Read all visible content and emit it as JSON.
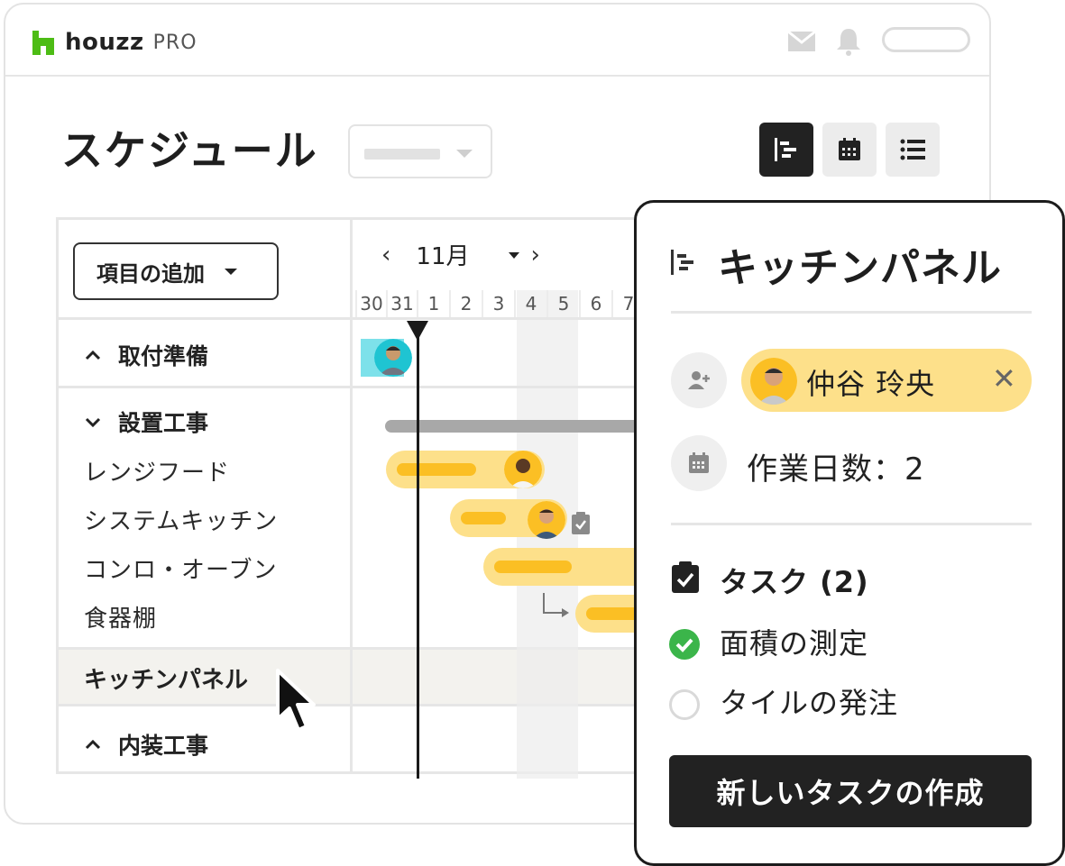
{
  "app": {
    "brand": "houzz",
    "brand_suffix": "PRO",
    "brand_color": "#4dbc15"
  },
  "header": {
    "icons": [
      "mail-icon",
      "bell-icon"
    ]
  },
  "page": {
    "title": "スケジュール"
  },
  "view_toggle": {
    "active": "gantt",
    "options": [
      "gantt",
      "calendar",
      "list"
    ]
  },
  "schedule": {
    "add_button_label": "項目の追加",
    "month_label": "11月",
    "days": [
      "30",
      "31",
      "1",
      "2",
      "3",
      "4",
      "5",
      "6",
      "7"
    ],
    "groups": [
      {
        "label": "取付準備",
        "expanded": false
      },
      {
        "label": "設置工事",
        "expanded": true,
        "items": [
          "レンジフード",
          "システムキッチン",
          "コンロ・オーブン",
          "食器棚"
        ]
      },
      {
        "label": "キッチンパネル",
        "selected": true
      },
      {
        "label": "内装工事",
        "expanded": false
      }
    ]
  },
  "detail": {
    "title": "キッチンパネル",
    "assignee_name": "仲谷 玲央",
    "workdays_label": "作業日数：2",
    "tasks_heading": "タスク (2)",
    "tasks": [
      {
        "label": "面積の測定",
        "done": true
      },
      {
        "label": "タイルの発注",
        "done": false
      }
    ],
    "new_task_button": "新しいタスクの作成"
  },
  "colors": {
    "bar_light": "#fde08a",
    "bar_dark": "#fbbf24",
    "accent_dark": "#222222",
    "check_green": "#3bb54a"
  }
}
